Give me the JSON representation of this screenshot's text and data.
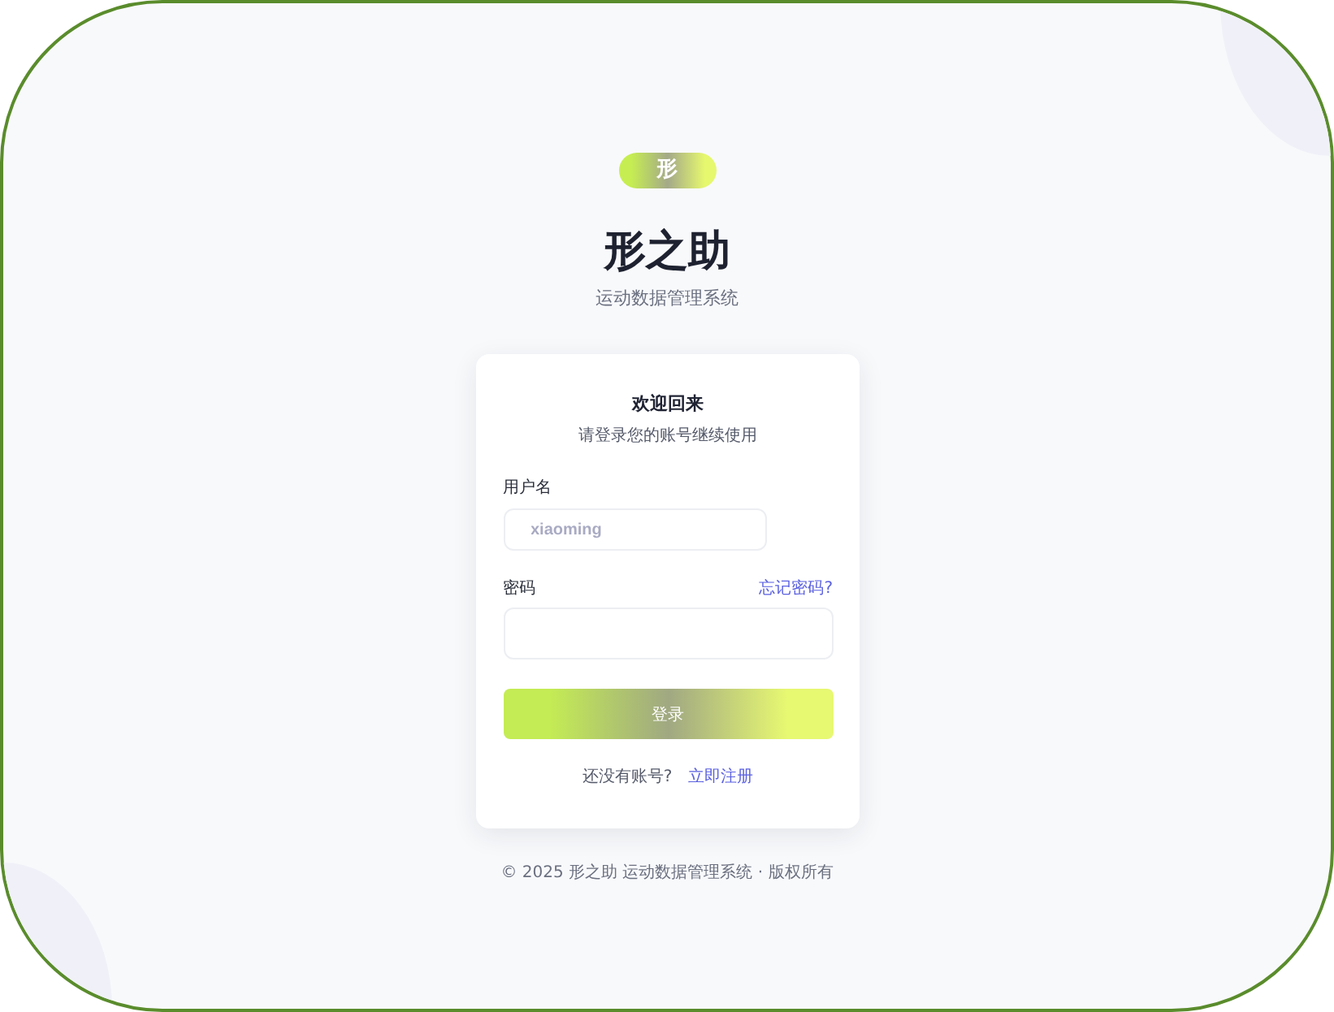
{
  "brand": {
    "badge": "形",
    "title": "形之助",
    "subtitle": "运动数据管理系统"
  },
  "login_card": {
    "heading": "欢迎回来",
    "subheading": "请登录您的账号继续使用",
    "fields": [
      {
        "kind": "text",
        "label": "用户名",
        "placeholder": "xiaoming"
      },
      {
        "kind": "password",
        "label": "密码",
        "link": "忘记密码?"
      }
    ],
    "submit": "登录",
    "signup_prompt": "还没有账号?",
    "signup_link": "立即注册"
  },
  "footer": "© 2025 形之助 运动数据管理系统 · 版权所有"
}
